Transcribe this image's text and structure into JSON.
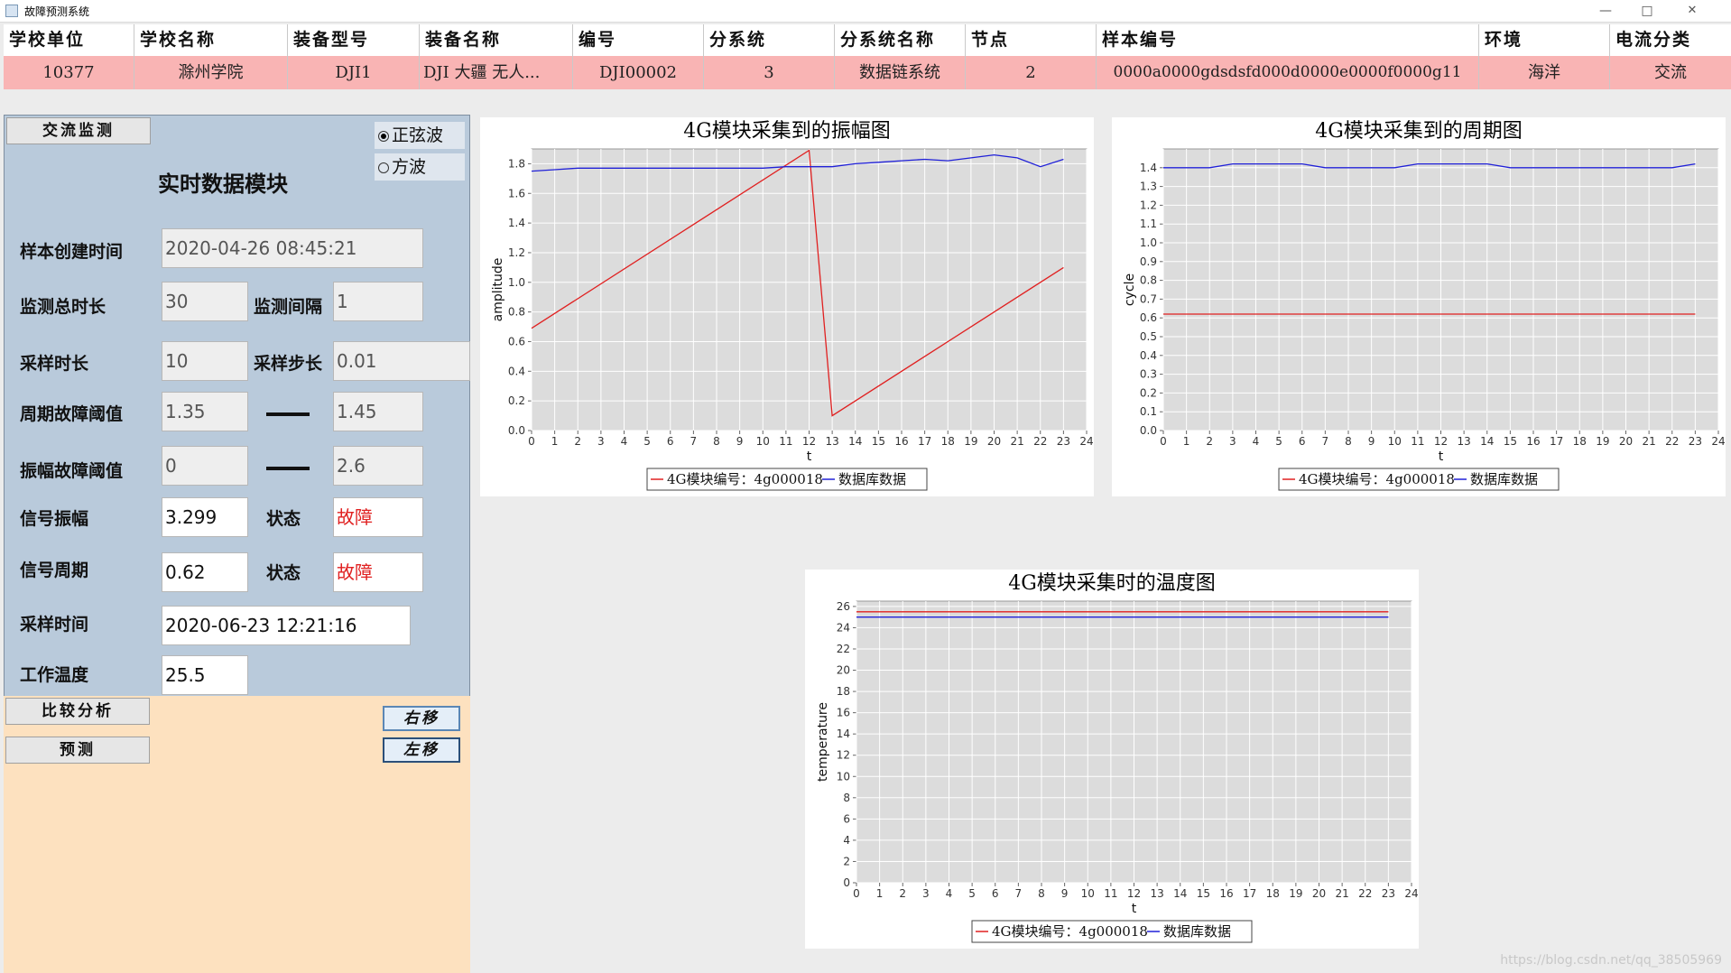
{
  "window": {
    "title": "故障预测系统",
    "minimize": "—",
    "maximize": "□",
    "close": "✕"
  },
  "table": {
    "headers": [
      "学校单位",
      "学校名称",
      "装备型号",
      "装备名称",
      "编号",
      "分系统",
      "分系统名称",
      "节点",
      "样本编号",
      "环境",
      "电流分类"
    ],
    "row": [
      "10377",
      "滁州学院",
      "DJI1",
      "DJI 大疆 无人...",
      "DJI00002",
      "3",
      "数据链系统",
      "2",
      "0000a0000gdsdsfd000d0000e0000f0000g11",
      "海洋",
      "交流"
    ]
  },
  "left": {
    "ac_monitor_btn": "交流监测",
    "radio_sine": "正弦波",
    "radio_square": "方波",
    "heading": "实时数据模块",
    "sample_create_time_label": "样本创建时间",
    "sample_create_time": "2020-04-26 08:45:21",
    "monitor_total_label": "监测总时长",
    "monitor_total": "30",
    "monitor_interval_label": "监测间隔",
    "monitor_interval": "1",
    "sample_duration_label": "采样时长",
    "sample_duration": "10",
    "sample_step_label": "采样步长",
    "sample_step": "0.01",
    "period_threshold_label": "周期故障阈值",
    "period_low": "1.35",
    "period_high": "1.45",
    "amp_threshold_label": "振幅故障阈值",
    "amp_low": "0",
    "amp_high": "2.6",
    "signal_amp_label": "信号振幅",
    "signal_amp": "3.299",
    "status_label": "状态",
    "amp_status": "故障",
    "signal_period_label": "信号周期",
    "signal_period": "0.62",
    "period_status": "故障",
    "sample_time_label": "采样时间",
    "sample_time": "2020-06-23 12:21:16",
    "work_temp_label": "工作温度",
    "work_temp": "25.5"
  },
  "bottom": {
    "compare_btn": "比较分析",
    "predict_btn": "预测",
    "right_btn": "右移",
    "left_btn": "左移"
  },
  "colors": {
    "red_series": "#e02020",
    "blue_series": "#2020d8",
    "plot_bg": "#dcdcdc"
  },
  "chart_data": [
    {
      "type": "line",
      "title": "4G模块采集到的振幅图",
      "xlabel": "t",
      "ylabel": "amplitude",
      "xlim": [
        0,
        24
      ],
      "ylim": [
        0,
        1.9
      ],
      "xticks": [
        0,
        1,
        2,
        3,
        4,
        5,
        6,
        7,
        8,
        9,
        10,
        11,
        12,
        13,
        14,
        15,
        16,
        17,
        18,
        19,
        20,
        21,
        22,
        23,
        24
      ],
      "yticks": [
        0.0,
        0.2,
        0.4,
        0.6,
        0.8,
        1.0,
        1.2,
        1.4,
        1.6,
        1.8
      ],
      "legend": "bottom",
      "series": [
        {
          "name": "4G模块编号：4g000018",
          "color": "#e02020",
          "x": [
            0,
            12,
            13,
            23
          ],
          "y": [
            0.69,
            1.89,
            0.1,
            1.1
          ]
        },
        {
          "name": "数据库数据",
          "color": "#2020d8",
          "x": [
            0,
            1,
            2,
            3,
            4,
            5,
            6,
            7,
            8,
            9,
            10,
            11,
            12,
            13,
            14,
            15,
            16,
            17,
            18,
            19,
            20,
            21,
            22,
            23
          ],
          "y": [
            1.75,
            1.76,
            1.77,
            1.77,
            1.77,
            1.77,
            1.77,
            1.77,
            1.77,
            1.77,
            1.77,
            1.78,
            1.78,
            1.78,
            1.8,
            1.81,
            1.82,
            1.83,
            1.82,
            1.84,
            1.86,
            1.84,
            1.78,
            1.83
          ]
        }
      ]
    },
    {
      "type": "line",
      "title": "4G模块采集到的周期图",
      "xlabel": "t",
      "ylabel": "cycle",
      "xlim": [
        0,
        24
      ],
      "ylim": [
        0,
        1.5
      ],
      "xticks": [
        0,
        1,
        2,
        3,
        4,
        5,
        6,
        7,
        8,
        9,
        10,
        11,
        12,
        13,
        14,
        15,
        16,
        17,
        18,
        19,
        20,
        21,
        22,
        23,
        24
      ],
      "yticks": [
        0.0,
        0.1,
        0.2,
        0.3,
        0.4,
        0.5,
        0.6,
        0.7,
        0.8,
        0.9,
        1.0,
        1.1,
        1.2,
        1.3,
        1.4
      ],
      "legend": "bottom",
      "series": [
        {
          "name": "4G模块编号：4g000018",
          "color": "#e02020",
          "x": [
            0,
            23
          ],
          "y": [
            0.62,
            0.62
          ]
        },
        {
          "name": "数据库数据",
          "color": "#2020d8",
          "x": [
            0,
            1,
            2,
            3,
            4,
            5,
            6,
            7,
            8,
            9,
            10,
            11,
            12,
            13,
            14,
            15,
            16,
            17,
            18,
            19,
            20,
            21,
            22,
            23
          ],
          "y": [
            1.4,
            1.4,
            1.4,
            1.42,
            1.42,
            1.42,
            1.42,
            1.4,
            1.4,
            1.4,
            1.4,
            1.42,
            1.42,
            1.42,
            1.42,
            1.4,
            1.4,
            1.4,
            1.4,
            1.4,
            1.4,
            1.4,
            1.4,
            1.42
          ]
        }
      ]
    },
    {
      "type": "line",
      "title": "4G模块采集时的温度图",
      "xlabel": "t",
      "ylabel": "temperature",
      "xlim": [
        0,
        24
      ],
      "ylim": [
        0,
        26.5
      ],
      "xticks": [
        0,
        1,
        2,
        3,
        4,
        5,
        6,
        7,
        8,
        9,
        10,
        11,
        12,
        13,
        14,
        15,
        16,
        17,
        18,
        19,
        20,
        21,
        22,
        23,
        24
      ],
      "yticks": [
        0,
        2,
        4,
        6,
        8,
        10,
        12,
        14,
        16,
        18,
        20,
        22,
        24,
        26
      ],
      "legend": "bottom",
      "series": [
        {
          "name": "4G模块编号：4g000018",
          "color": "#e02020",
          "x": [
            0,
            23
          ],
          "y": [
            25.5,
            25.5
          ]
        },
        {
          "name": "数据库数据",
          "color": "#2020d8",
          "x": [
            0,
            23
          ],
          "y": [
            25.0,
            25.0
          ]
        }
      ]
    }
  ]
}
